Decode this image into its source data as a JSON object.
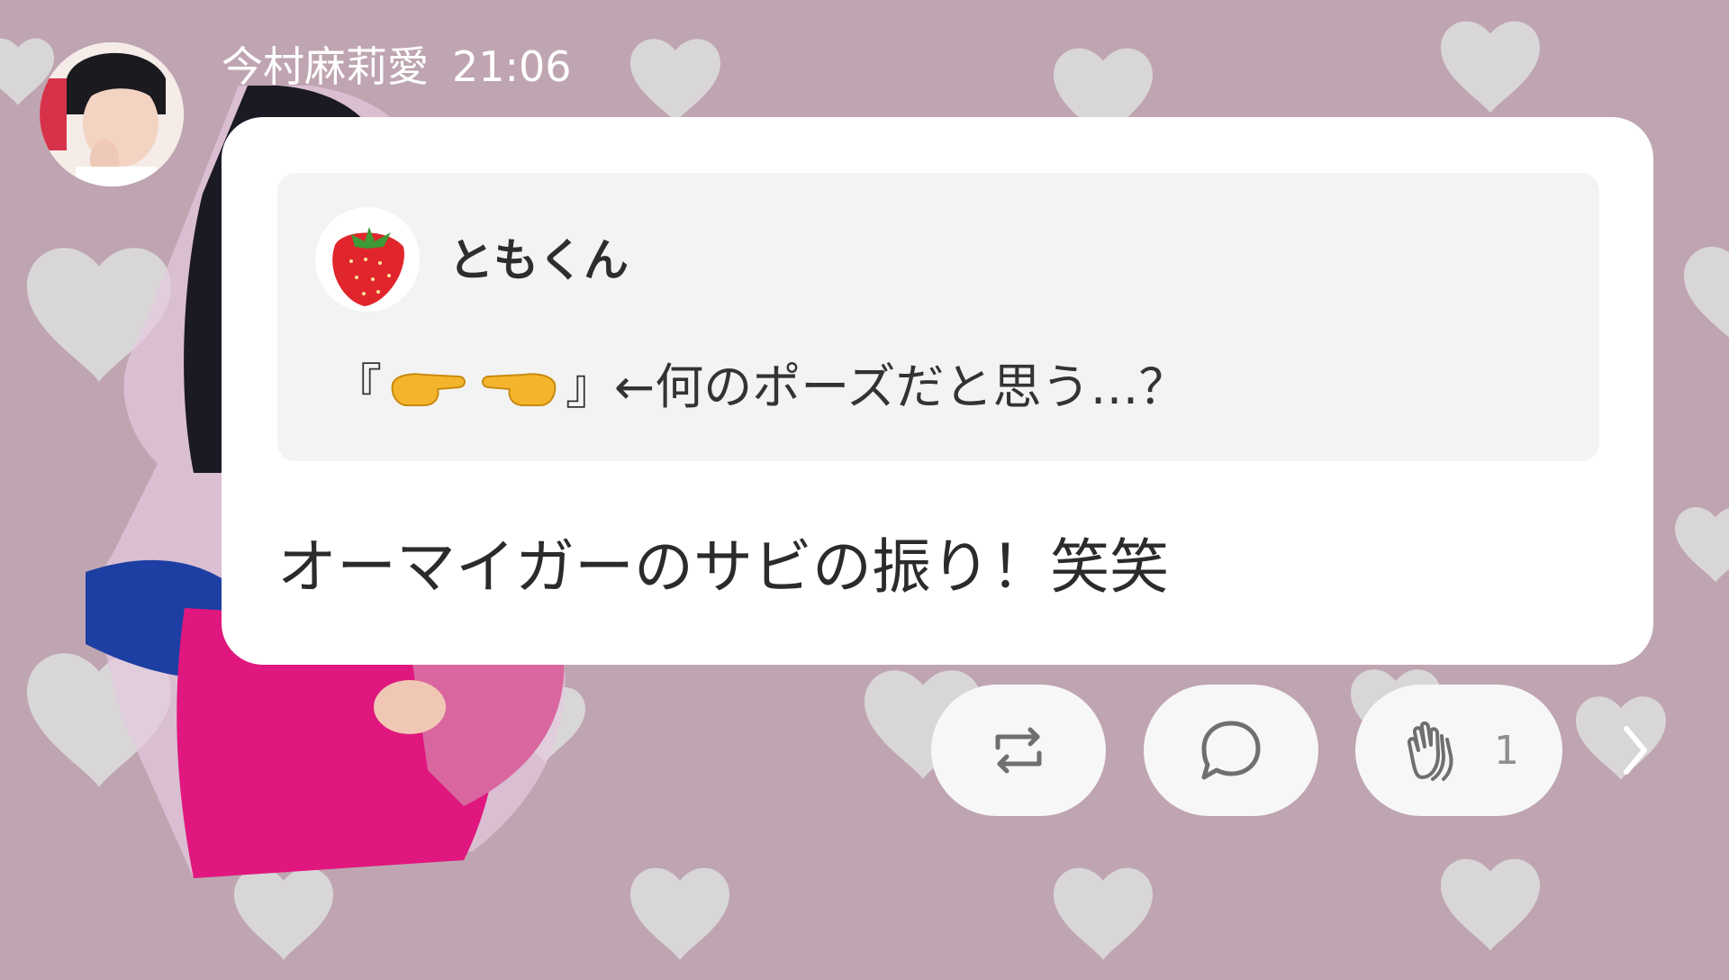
{
  "post": {
    "author": "今村麻莉愛",
    "time": "21:06",
    "quote": {
      "user": "ともくん",
      "avatar_icon": "strawberry-icon",
      "text_open": "『",
      "text_close": "』←何のポーズだと思う…？",
      "emoji_icons": [
        "backhand-pointing-right-icon",
        "backhand-pointing-left-icon"
      ]
    },
    "message": "オーマイガーのサビの振り！笑笑"
  },
  "actions": {
    "repost_icon": "repost-icon",
    "comment_icon": "comment-icon",
    "clap_icon": "clapping-hands-icon",
    "clap_count": "1",
    "more_icon": "chevron-right-icon"
  },
  "colors": {
    "background": "#bfa5b1",
    "heart": "#d9d6d8",
    "bubble": "#ffffff",
    "quote_bg": "#f3f3f4",
    "action_bg": "#f7f7f7"
  }
}
